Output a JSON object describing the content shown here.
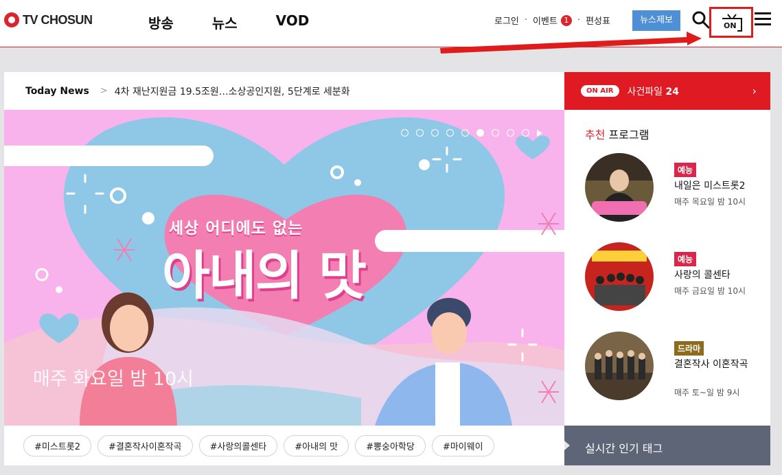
{
  "header": {
    "logo_text": "TV CHOSUN",
    "nav": [
      "방송",
      "뉴스",
      "VOD"
    ],
    "login": "로그인",
    "event": "이벤트",
    "event_count": "1",
    "schedule": "편성표",
    "news_tip": "뉴스제보",
    "onair_icon_label": "ON"
  },
  "ticker": {
    "label": "Today News",
    "headline": "4차 재난지원금 19.5조원…소상공인지원, 5단계로 세분화"
  },
  "banner": {
    "title_small": "세상 어디에도 없는",
    "title": "아내의 맛",
    "schedule": "매주 화요일 밤 10시"
  },
  "tags": [
    "#미스트롯2",
    "#결혼작사이혼작곡",
    "#사랑의콜센타",
    "#아내의 맛",
    "#뽕숭아학당",
    "#마이웨이"
  ],
  "side": {
    "onair_badge": "ON AIR",
    "onair_program": "사건파일",
    "onair_number": "24",
    "recommend_red": "추천",
    "recommend_rest": "프로그램",
    "programs": [
      {
        "genre": "예능",
        "name": "내일은 미스트롯2",
        "time": "매주 목요일 밤 10시",
        "genre_color": "#d9264a"
      },
      {
        "genre": "예능",
        "name": "사랑의 콜센타",
        "time": "매주 금요일 밤 10시",
        "genre_color": "#d9264a"
      },
      {
        "genre": "드라마",
        "name": "결혼작사 이혼작곡",
        "time": "매주 토~일 밤 9시",
        "genre_color": "#8d6a1c"
      }
    ]
  },
  "popular_tags_label": "실시간 인기 태그"
}
